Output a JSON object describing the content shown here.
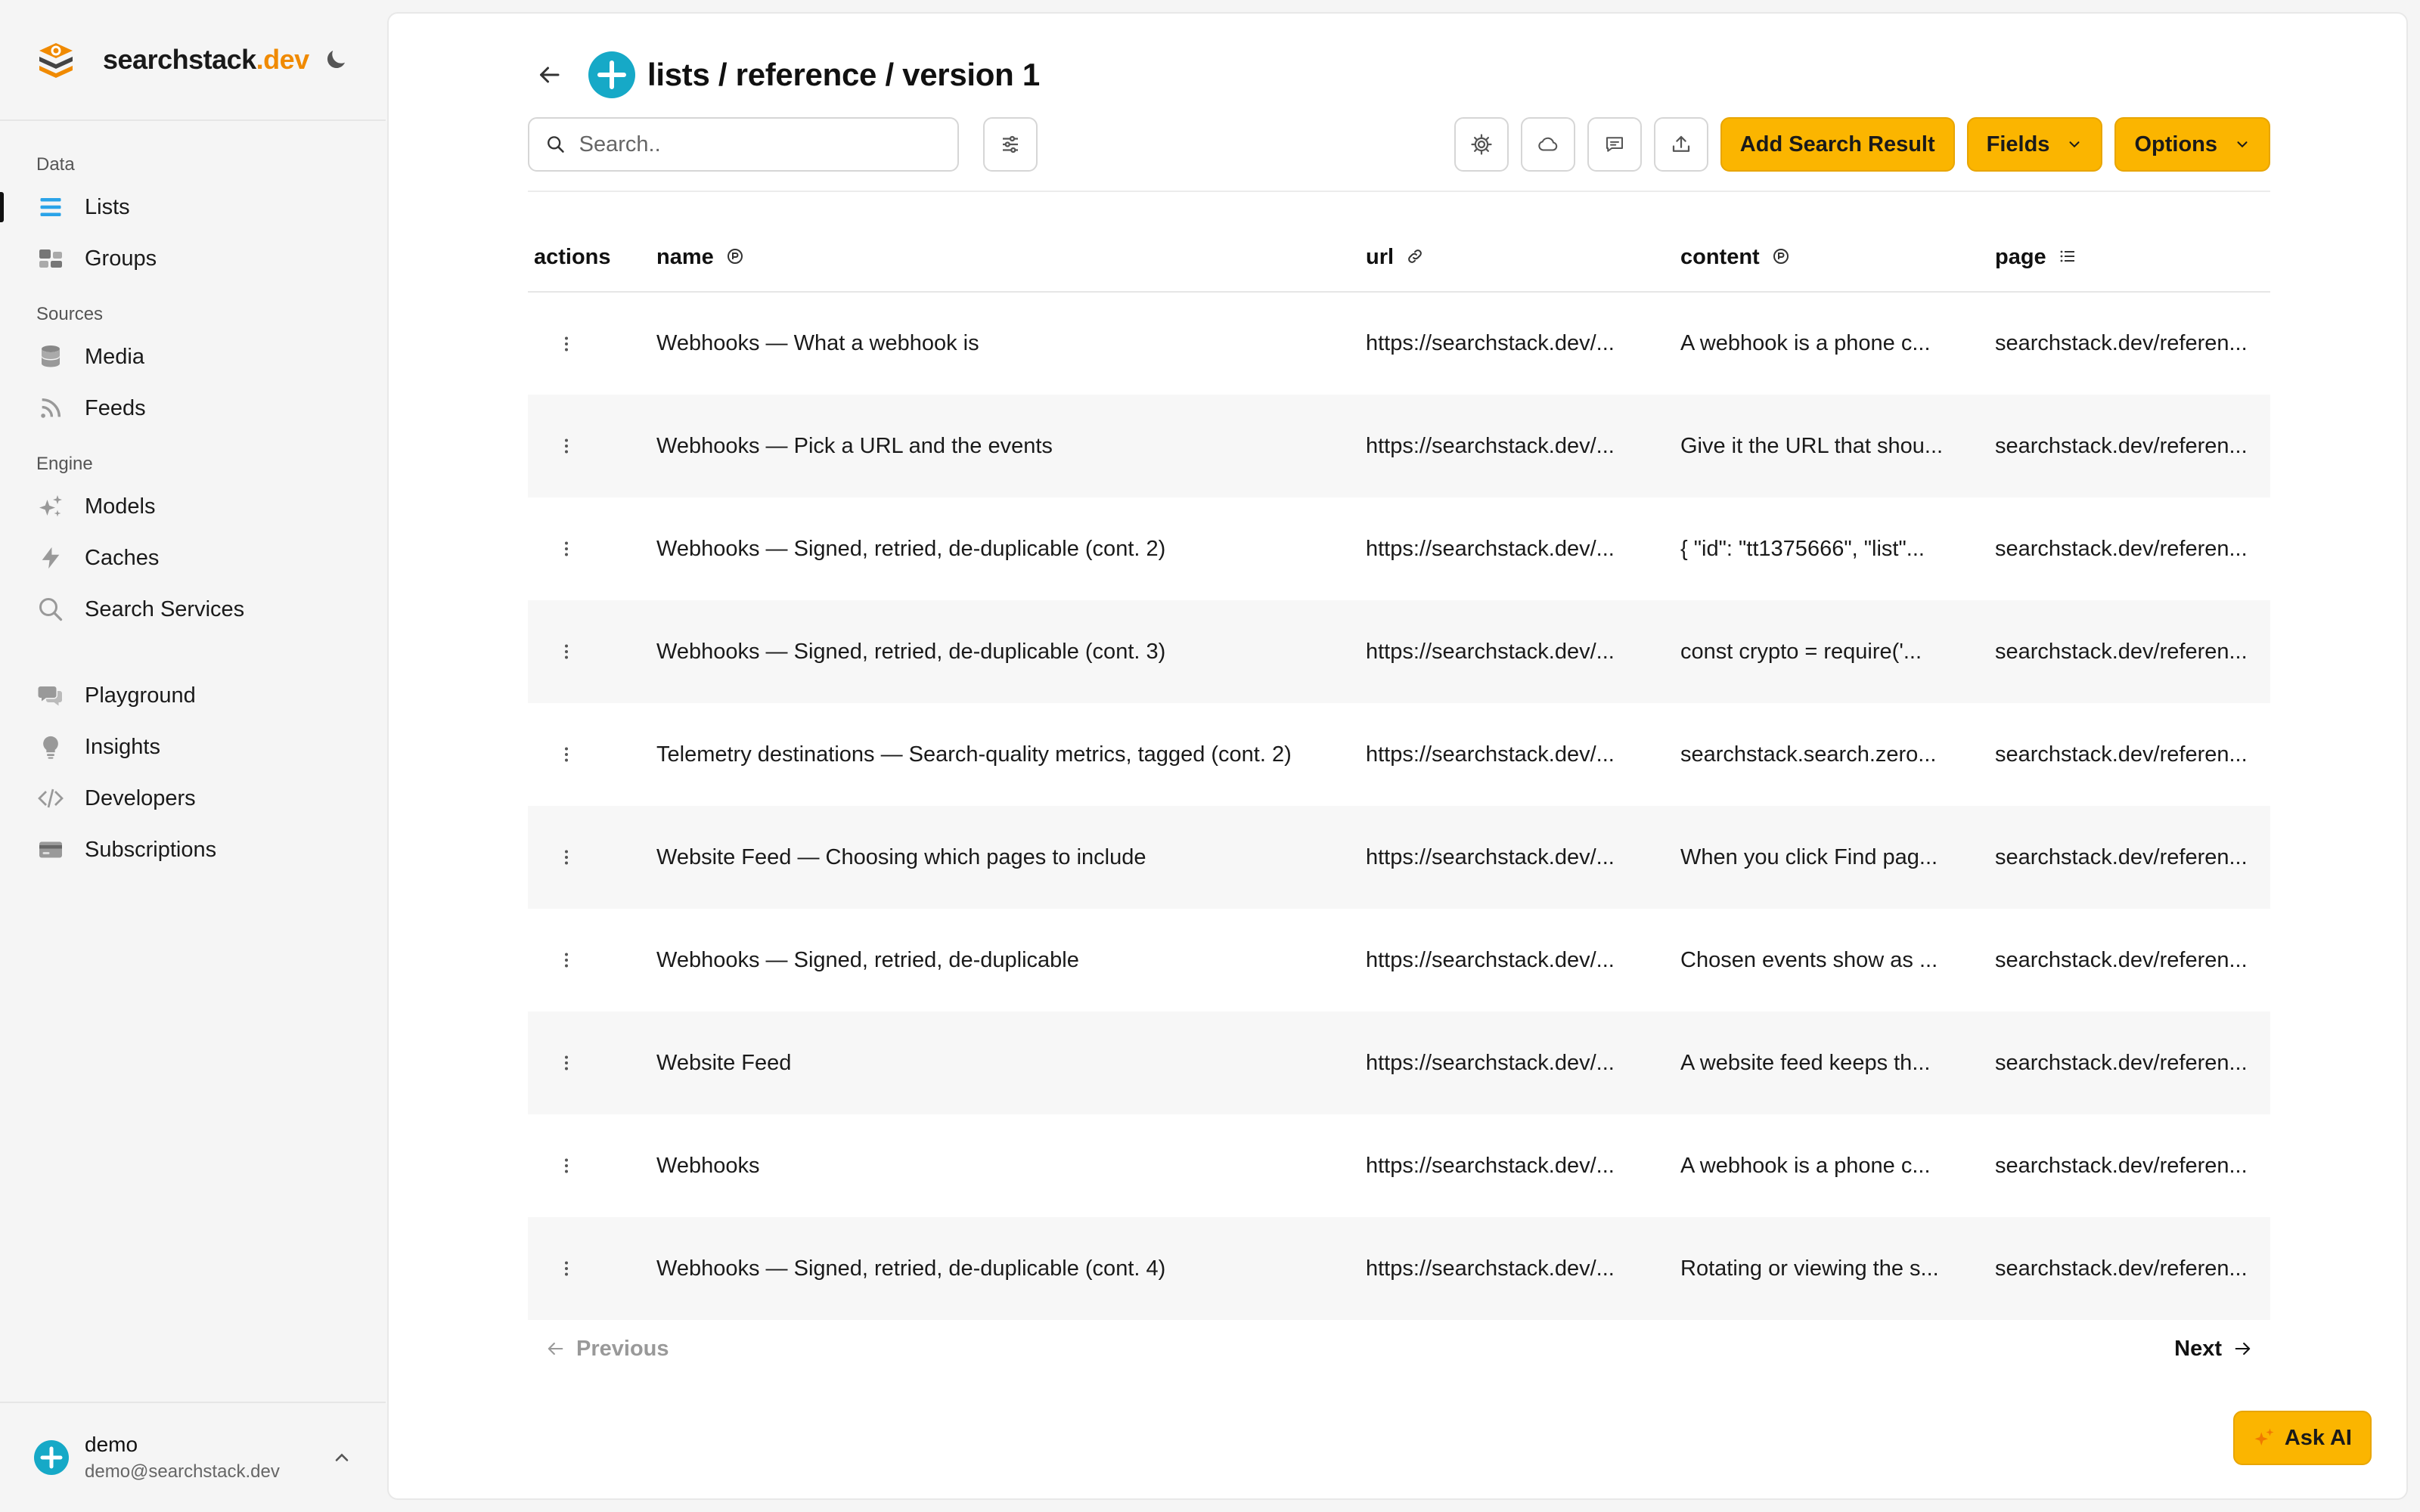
{
  "brand": {
    "name": "searchstack",
    "suffix": ".dev"
  },
  "sidebar": {
    "sections": [
      {
        "title": "Data",
        "items": [
          {
            "label": "Lists",
            "icon": "list-icon"
          },
          {
            "label": "Groups",
            "icon": "groups-icon"
          }
        ]
      },
      {
        "title": "Sources",
        "items": [
          {
            "label": "Media",
            "icon": "database-icon"
          },
          {
            "label": "Feeds",
            "icon": "rss-icon"
          }
        ]
      },
      {
        "title": "Engine",
        "items": [
          {
            "label": "Models",
            "icon": "sparkles-icon"
          },
          {
            "label": "Caches",
            "icon": "bolt-icon"
          },
          {
            "label": "Search Services",
            "icon": "search-icon"
          }
        ]
      },
      {
        "title": "",
        "items": [
          {
            "label": "Playground",
            "icon": "chat-icon"
          },
          {
            "label": "Insights",
            "icon": "lightbulb-icon"
          },
          {
            "label": "Developers",
            "icon": "code-icon"
          },
          {
            "label": "Subscriptions",
            "icon": "credit-card-icon"
          }
        ]
      }
    ],
    "active": "Lists"
  },
  "user": {
    "name": "demo",
    "email": "demo@searchstack.dev"
  },
  "header": {
    "title": "lists / reference / version 1"
  },
  "toolbar": {
    "search_placeholder": "Search..",
    "add_label": "Add Search Result",
    "fields_label": "Fields",
    "options_label": "Options"
  },
  "table": {
    "columns": [
      "actions",
      "name",
      "url",
      "content",
      "page"
    ],
    "rows": [
      {
        "name": "Webhooks — What a webhook is",
        "url": "https://searchstack.dev/...",
        "content": "A webhook is a phone c...",
        "page": "searchstack.dev/referen..."
      },
      {
        "name": "Webhooks — Pick a URL and the events",
        "url": "https://searchstack.dev/...",
        "content": "Give it the URL that shou...",
        "page": "searchstack.dev/referen..."
      },
      {
        "name": "Webhooks — Signed, retried, de-duplicable (cont. 2)",
        "url": "https://searchstack.dev/...",
        "content": "{ \"id\": \"tt1375666\", \"list\"...",
        "page": "searchstack.dev/referen..."
      },
      {
        "name": "Webhooks — Signed, retried, de-duplicable (cont. 3)",
        "url": "https://searchstack.dev/...",
        "content": "const crypto = require('...",
        "page": "searchstack.dev/referen..."
      },
      {
        "name": "Telemetry destinations — Search-quality metrics, tagged (cont. 2)",
        "url": "https://searchstack.dev/...",
        "content": "searchstack.search.zero...",
        "page": "searchstack.dev/referen..."
      },
      {
        "name": "Website Feed — Choosing which pages to include",
        "url": "https://searchstack.dev/...",
        "content": "When you click Find pag...",
        "page": "searchstack.dev/referen..."
      },
      {
        "name": "Webhooks — Signed, retried, de-duplicable",
        "url": "https://searchstack.dev/...",
        "content": "Chosen events show as ...",
        "page": "searchstack.dev/referen..."
      },
      {
        "name": "Website Feed",
        "url": "https://searchstack.dev/...",
        "content": "A website feed keeps th...",
        "page": "searchstack.dev/referen..."
      },
      {
        "name": "Webhooks",
        "url": "https://searchstack.dev/...",
        "content": "A webhook is a phone c...",
        "page": "searchstack.dev/referen..."
      },
      {
        "name": "Webhooks — Signed, retried, de-duplicable (cont. 4)",
        "url": "https://searchstack.dev/...",
        "content": "Rotating or viewing the s...",
        "page": "searchstack.dev/referen..."
      }
    ]
  },
  "pager": {
    "prev_label": "Previous",
    "next_label": "Next"
  },
  "ask_ai_label": "Ask AI",
  "colors": {
    "accent": "#fbb500",
    "brand_orange": "#f08a00",
    "teal": "#16a9c7",
    "lists_blue": "#2aa3e8"
  }
}
